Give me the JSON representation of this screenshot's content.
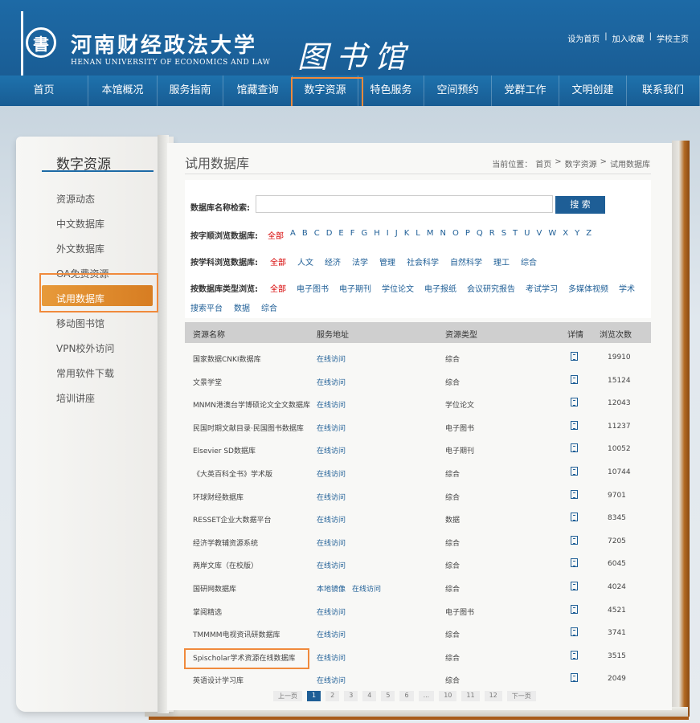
{
  "header": {
    "logo_char": "書",
    "university_cn": "河南财经政法大学",
    "university_en": "HENAN UNIVERSITY OF ECONOMICS AND LAW",
    "library_title": "图书馆",
    "top_links": [
      "设为首页",
      "|",
      "加入收藏",
      "|",
      "学校主页"
    ]
  },
  "nav": [
    {
      "label": "首页",
      "width": 110
    },
    {
      "label": "本馆概况",
      "width": 86
    },
    {
      "label": "服务指南",
      "width": 82
    },
    {
      "label": "馆藏查询",
      "width": 86
    },
    {
      "label": "数字资源",
      "width": 82
    },
    {
      "label": "特色服务",
      "width": 82
    },
    {
      "label": "空间预约",
      "width": 84
    },
    {
      "label": "党群工作",
      "width": 84
    },
    {
      "label": "文明创建",
      "width": 84
    },
    {
      "label": "联系我们",
      "width": 91
    }
  ],
  "sidebar": {
    "title": "数字资源",
    "items": [
      "资源动态",
      "中文数据库",
      "外文数据库",
      "OA免费资源",
      "试用数据库",
      "移动图书馆",
      "VPN校外访问",
      "常用软件下载",
      "培训讲座"
    ],
    "active_index": 4
  },
  "content": {
    "title": "试用数据库",
    "breadcrumb": [
      "当前位置：",
      "首页",
      ">",
      "数字资源",
      ">",
      "试用数据库"
    ],
    "search": {
      "label": "数据库名称检索:",
      "value": "",
      "placeholder": "",
      "button": "搜 索"
    },
    "alpha": {
      "label": "按字顺浏览数据库:",
      "all": "全部",
      "letters": [
        "A",
        "B",
        "C",
        "D",
        "E",
        "F",
        "G",
        "H",
        "I",
        "J",
        "K",
        "L",
        "M",
        "N",
        "O",
        "P",
        "Q",
        "R",
        "S",
        "T",
        "U",
        "V",
        "W",
        "X",
        "Y",
        "Z"
      ]
    },
    "subject": {
      "label": "按学科浏览数据库:",
      "items": [
        "全部",
        "人文",
        "经济",
        "法学",
        "管理",
        "社会科学",
        "自然科学",
        "理工",
        "综合"
      ]
    },
    "type": {
      "label": "按数据库类型浏览:",
      "items": [
        "全部",
        "电子图书",
        "电子期刊",
        "学位论文",
        "电子报纸",
        "会议研究报告",
        "考试学习",
        "多媒体视频",
        "学术"
      ],
      "items2": [
        "搜索平台",
        "数据",
        "综合"
      ]
    },
    "table": {
      "headers": [
        "资源名称",
        "服务地址",
        "资源类型",
        "详情",
        "浏览次数"
      ],
      "rows": [
        {
          "name": "国家数据CNKI数据库",
          "links": [
            "在线访问"
          ],
          "type": "综合",
          "count": "19910"
        },
        {
          "name": "文景学堂",
          "links": [
            "在线访问"
          ],
          "type": "综合",
          "count": "15124"
        },
        {
          "name": "MNMN港澳台学博硕论文全文数据库",
          "links": [
            "在线访问"
          ],
          "type": "学位论文",
          "count": "12043"
        },
        {
          "name": "民国时期文献目录·民国图书数据库",
          "links": [
            "在线访问"
          ],
          "type": "电子图书",
          "count": "11237"
        },
        {
          "name": "Elsevier SD数据库",
          "links": [
            "在线访问"
          ],
          "type": "电子期刊",
          "count": "10052"
        },
        {
          "name": "《大英百科全书》学术版",
          "links": [
            "在线访问"
          ],
          "type": "综合",
          "count": "10744"
        },
        {
          "name": "环球财经数据库",
          "links": [
            "在线访问"
          ],
          "type": "综合",
          "count": "9701"
        },
        {
          "name": "RESSET企业大数据平台",
          "links": [
            "在线访问"
          ],
          "type": "数据",
          "count": "8345"
        },
        {
          "name": "经济学教辅资源系统",
          "links": [
            "在线访问"
          ],
          "type": "综合",
          "count": "7205"
        },
        {
          "name": "两岸文库（在校版）",
          "links": [
            "在线访问"
          ],
          "type": "综合",
          "count": "6045"
        },
        {
          "name": "国研网数据库",
          "links": [
            "本地镜像",
            "在线访问"
          ],
          "type": "综合",
          "count": "4024"
        },
        {
          "name": "掌阅精选",
          "links": [
            "在线访问"
          ],
          "type": "电子图书",
          "count": "4521"
        },
        {
          "name": "TMMMM电视资讯研数据库",
          "links": [
            "在线访问"
          ],
          "type": "综合",
          "count": "3741"
        },
        {
          "name": "Spischolar学术资源在线数据库",
          "links": [
            "在线访问"
          ],
          "type": "综合",
          "count": "3515"
        },
        {
          "name": "英语设计学习库",
          "links": [
            "在线访问"
          ],
          "type": "综合",
          "count": "2049"
        }
      ]
    },
    "pager": [
      "上一页",
      "1",
      "2",
      "3",
      "4",
      "5",
      "6",
      "...",
      "10",
      "11",
      "12",
      "下一页"
    ]
  },
  "colors": {
    "brand": "#1d6aa6",
    "highlight": "#f08a3c",
    "active": "#e08a2e",
    "link": "#1e5e96"
  }
}
